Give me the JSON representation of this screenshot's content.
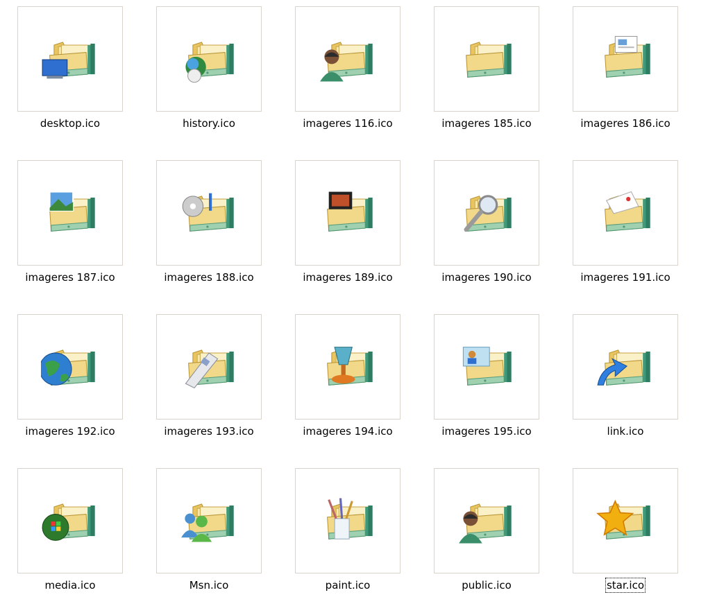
{
  "files": [
    {
      "label": "desktop.ico",
      "icon": "folder-desktop-icon"
    },
    {
      "label": "history.ico",
      "icon": "folder-history-icon"
    },
    {
      "label": "imageres 116.ico",
      "icon": "folder-user-icon"
    },
    {
      "label": "imageres 185.ico",
      "icon": "folder-icon"
    },
    {
      "label": "imageres 186.ico",
      "icon": "folder-documents-icon"
    },
    {
      "label": "imageres 187.ico",
      "icon": "folder-pictures-icon"
    },
    {
      "label": "imageres 188.ico",
      "icon": "folder-music-icon"
    },
    {
      "label": "imageres 189.ico",
      "icon": "folder-videos-icon"
    },
    {
      "label": "imageres 190.ico",
      "icon": "folder-search-icon"
    },
    {
      "label": "imageres 191.ico",
      "icon": "folder-mail-icon"
    },
    {
      "label": "imageres 192.ico",
      "icon": "folder-network-icon"
    },
    {
      "label": "imageres 193.ico",
      "icon": "folder-devices-icon"
    },
    {
      "label": "imageres 194.ico",
      "icon": "folder-games-icon"
    },
    {
      "label": "imageres 195.ico",
      "icon": "folder-contacts-icon"
    },
    {
      "label": "link.ico",
      "icon": "folder-link-icon"
    },
    {
      "label": "media.ico",
      "icon": "folder-media-icon"
    },
    {
      "label": "Msn.ico",
      "icon": "folder-msn-icon"
    },
    {
      "label": "paint.ico",
      "icon": "folder-paint-icon"
    },
    {
      "label": "public.ico",
      "icon": "folder-public-icon"
    },
    {
      "label": "star.ico",
      "icon": "folder-favorites-icon"
    }
  ],
  "focused_index": 19
}
